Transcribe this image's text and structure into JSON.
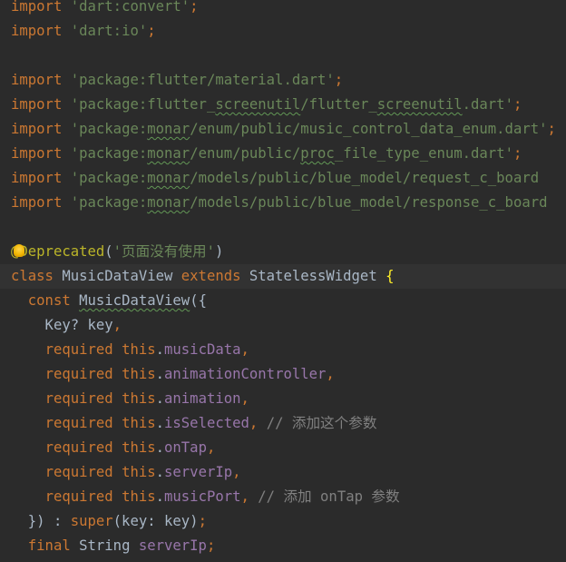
{
  "editor": {
    "lines": [
      [
        {
          "t": "import",
          "c": "kw"
        },
        {
          "t": " "
        },
        {
          "t": "'dart:convert'",
          "c": "str"
        },
        {
          "t": ";",
          "c": "kw"
        }
      ],
      [
        {
          "t": "import",
          "c": "kw"
        },
        {
          "t": " "
        },
        {
          "t": "'dart:io'",
          "c": "str"
        },
        {
          "t": ";",
          "c": "kw"
        }
      ],
      [],
      [
        {
          "t": "import",
          "c": "kw"
        },
        {
          "t": " "
        },
        {
          "t": "'package:flutter/material.dart'",
          "c": "str"
        },
        {
          "t": ";",
          "c": "kw"
        }
      ],
      [
        {
          "t": "import",
          "c": "kw"
        },
        {
          "t": " "
        },
        {
          "t": "'package:flutter_",
          "c": "str"
        },
        {
          "t": "screenutil",
          "c": "str typo"
        },
        {
          "t": "/flutter_",
          "c": "str"
        },
        {
          "t": "screenutil",
          "c": "str typo"
        },
        {
          "t": ".dart'",
          "c": "str"
        },
        {
          "t": ";",
          "c": "kw"
        }
      ],
      [
        {
          "t": "import",
          "c": "kw"
        },
        {
          "t": " "
        },
        {
          "t": "'package:",
          "c": "str"
        },
        {
          "t": "monar",
          "c": "str typo"
        },
        {
          "t": "/enum/public/music_control_data_enum.dart'",
          "c": "str"
        },
        {
          "t": ";",
          "c": "kw"
        }
      ],
      [
        {
          "t": "import",
          "c": "kw"
        },
        {
          "t": " "
        },
        {
          "t": "'package:",
          "c": "str"
        },
        {
          "t": "monar",
          "c": "str typo"
        },
        {
          "t": "/enum/public/",
          "c": "str"
        },
        {
          "t": "proc",
          "c": "str typo"
        },
        {
          "t": "_file_type_enum.dart'",
          "c": "str"
        },
        {
          "t": ";",
          "c": "kw"
        }
      ],
      [
        {
          "t": "import",
          "c": "kw"
        },
        {
          "t": " "
        },
        {
          "t": "'package:",
          "c": "str"
        },
        {
          "t": "monar",
          "c": "str typo"
        },
        {
          "t": "/models/public/blue_model/request_c_board",
          "c": "str"
        }
      ],
      [
        {
          "t": "import",
          "c": "kw"
        },
        {
          "t": " "
        },
        {
          "t": "'package:",
          "c": "str"
        },
        {
          "t": "monar",
          "c": "str typo"
        },
        {
          "t": "/models/public/blue_model/response_c_board",
          "c": "str"
        }
      ],
      [],
      [
        {
          "t": "@Deprecated",
          "c": "ann"
        },
        {
          "t": "("
        },
        {
          "t": "'页面没有使用'",
          "c": "str"
        },
        {
          "t": ")"
        }
      ],
      [
        {
          "t": "class",
          "c": "kw"
        },
        {
          "t": " MusicDataView "
        },
        {
          "t": "extends",
          "c": "kw"
        },
        {
          "t": " StatelessWidget "
        },
        {
          "t": "{",
          "c": "bracket-hl"
        }
      ],
      [
        {
          "t": "  "
        },
        {
          "t": "const",
          "c": "kw"
        },
        {
          "t": " "
        },
        {
          "t": "MusicDataView",
          "c": "typo"
        },
        {
          "t": "({"
        }
      ],
      [
        {
          "t": "    Key? key"
        },
        {
          "t": ",",
          "c": "kw"
        }
      ],
      [
        {
          "t": "    "
        },
        {
          "t": "required",
          "c": "kw"
        },
        {
          "t": " "
        },
        {
          "t": "this",
          "c": "kw"
        },
        {
          "t": "."
        },
        {
          "t": "musicData",
          "c": "fld"
        },
        {
          "t": ",",
          "c": "kw"
        }
      ],
      [
        {
          "t": "    "
        },
        {
          "t": "required",
          "c": "kw"
        },
        {
          "t": " "
        },
        {
          "t": "this",
          "c": "kw"
        },
        {
          "t": "."
        },
        {
          "t": "animationController",
          "c": "fld"
        },
        {
          "t": ",",
          "c": "kw"
        }
      ],
      [
        {
          "t": "    "
        },
        {
          "t": "required",
          "c": "kw"
        },
        {
          "t": " "
        },
        {
          "t": "this",
          "c": "kw"
        },
        {
          "t": "."
        },
        {
          "t": "animation",
          "c": "fld"
        },
        {
          "t": ",",
          "c": "kw"
        }
      ],
      [
        {
          "t": "    "
        },
        {
          "t": "required",
          "c": "kw"
        },
        {
          "t": " "
        },
        {
          "t": "this",
          "c": "kw"
        },
        {
          "t": "."
        },
        {
          "t": "isSelected",
          "c": "fld"
        },
        {
          "t": ",",
          "c": "kw"
        },
        {
          "t": " "
        },
        {
          "t": "// 添加这个参数",
          "c": "com"
        }
      ],
      [
        {
          "t": "    "
        },
        {
          "t": "required",
          "c": "kw"
        },
        {
          "t": " "
        },
        {
          "t": "this",
          "c": "kw"
        },
        {
          "t": "."
        },
        {
          "t": "onTap",
          "c": "fld"
        },
        {
          "t": ",",
          "c": "kw"
        }
      ],
      [
        {
          "t": "    "
        },
        {
          "t": "required",
          "c": "kw"
        },
        {
          "t": " "
        },
        {
          "t": "this",
          "c": "kw"
        },
        {
          "t": "."
        },
        {
          "t": "serverIp",
          "c": "fld"
        },
        {
          "t": ",",
          "c": "kw"
        }
      ],
      [
        {
          "t": "    "
        },
        {
          "t": "required",
          "c": "kw"
        },
        {
          "t": " "
        },
        {
          "t": "this",
          "c": "kw"
        },
        {
          "t": "."
        },
        {
          "t": "musicPort",
          "c": "fld"
        },
        {
          "t": ",",
          "c": "kw"
        },
        {
          "t": " "
        },
        {
          "t": "// 添加 onTap 参数",
          "c": "com"
        }
      ],
      [
        {
          "t": "  }) : "
        },
        {
          "t": "super",
          "c": "kw"
        },
        {
          "t": "(key: key)"
        },
        {
          "t": ";",
          "c": "kw"
        }
      ],
      [
        {
          "t": "  "
        },
        {
          "t": "final",
          "c": "kw"
        },
        {
          "t": " String "
        },
        {
          "t": "serverIp",
          "c": "fld"
        },
        {
          "t": ";",
          "c": "kw"
        }
      ]
    ],
    "current_line": 11,
    "intention_bulb_line": 10
  }
}
